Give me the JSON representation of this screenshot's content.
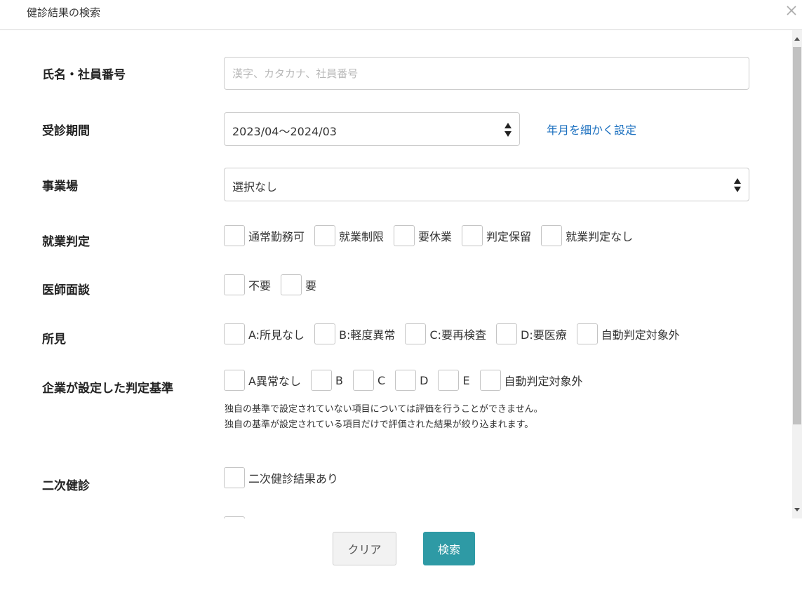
{
  "dialog": {
    "title": "健診結果の検索"
  },
  "fields": {
    "name": {
      "label": "氏名・社員番号",
      "placeholder": "漢字、カタカナ、社員番号",
      "value": ""
    },
    "period": {
      "label": "受診期間",
      "value": "2023/04～2024/03",
      "link": "年月を細かく設定"
    },
    "workplace": {
      "label": "事業場",
      "value": "選択なし"
    },
    "employment": {
      "label": "就業判定",
      "options": [
        "通常勤務可",
        "就業制限",
        "要休業",
        "判定保留",
        "就業判定なし"
      ]
    },
    "interview": {
      "label": "医師面談",
      "options": [
        "不要",
        "要"
      ]
    },
    "findings": {
      "label": "所見",
      "options": [
        "A:所見なし",
        "B:軽度異常",
        "C:要再検査",
        "D:要医療",
        "自動判定対象外"
      ]
    },
    "company_criteria": {
      "label": "企業が設定した判定基準",
      "options": [
        "A異常なし",
        "B",
        "C",
        "D",
        "E",
        "自動判定対象外"
      ],
      "note_1": "独自の基準で設定されていない項目については評価を行うことができません。",
      "note_2": "独自の基準が設定されている項目だけで評価された結果が絞り込まれます。"
    },
    "secondary": {
      "label": "二次健診",
      "options": [
        "二次健診結果あり"
      ]
    }
  },
  "actions": {
    "clear": "クリア",
    "search": "検索"
  },
  "colors": {
    "accent": "#2e9aa5",
    "link": "#1a6fbf"
  },
  "icons": {
    "close": "close-icon",
    "select_arrows": "sort-arrows-icon"
  }
}
